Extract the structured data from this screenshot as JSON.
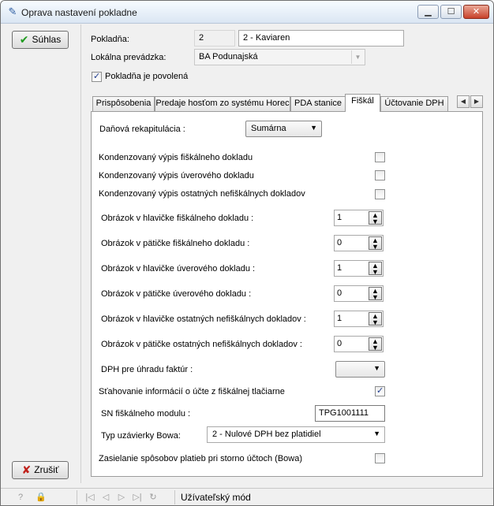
{
  "window": {
    "title": "Oprava nastavení pokladne",
    "icon": "register-icon"
  },
  "buttons": {
    "ok_label": "Súhlas",
    "cancel_label": "Zrušiť"
  },
  "header": {
    "register_label": "Pokladňa:",
    "register_number": "2",
    "register_name": "2 - Kaviaren",
    "branch_label": "Lokálna prevádzka:",
    "branch_value": "BA Podunajská",
    "enabled_label": "Pokladňa je povolená",
    "enabled_checked": true
  },
  "tabs": [
    {
      "label": "Prispôsobenia",
      "active": false
    },
    {
      "label": "Predaje hosťom zo systému Horec",
      "active": false
    },
    {
      "label": "PDA stanice",
      "active": false
    },
    {
      "label": "Fiškál",
      "active": true
    },
    {
      "label": "Účtovanie DPH",
      "active": false
    }
  ],
  "fiscal": {
    "tax_recap_label": "Daňová rekapitulácia :",
    "tax_recap_value": "Sumárna",
    "condensed_fiscal_label": "Kondenzovaný výpis fiškálneho dokladu",
    "condensed_fiscal_checked": false,
    "condensed_credit_label": "Kondenzovaný výpis úverového dokladu",
    "condensed_credit_checked": false,
    "condensed_other_label": "Kondenzovaný výpis ostatných nefiškálnych dokladov",
    "condensed_other_checked": false,
    "img_fiscal_header_label": "Obrázok v hlavičke fiškálneho dokladu :",
    "img_fiscal_header_value": "1",
    "img_fiscal_footer_label": "Obrázok v pätičke fiškálneho dokladu :",
    "img_fiscal_footer_value": "0",
    "img_credit_header_label": "Obrázok v hlavičke úverového dokladu :",
    "img_credit_header_value": "1",
    "img_credit_footer_label": "Obrázok v pätičke úverového dokladu :",
    "img_credit_footer_value": "0",
    "img_other_header_label": "Obrázok v hlavičke ostatných nefiškálnych dokladov :",
    "img_other_header_value": "1",
    "img_other_footer_label": "Obrázok v pätičke ostatných nefiškálnych dokladov :",
    "img_other_footer_value": "0",
    "vat_invoice_label": "DPH pre úhradu faktúr :",
    "vat_invoice_value": "",
    "download_info_label": "Sťahovanie informácií o účte z fiškálnej tlačiarne",
    "download_info_checked": true,
    "sn_label": "SN fiškálneho modulu :",
    "sn_value": "TPG1001111",
    "bowa_type_label": "Typ uzávierky Bowa:",
    "bowa_type_value": "2 - Nulové DPH bez platidiel",
    "bowa_storno_label": "Zasielanie spôsobov platieb pri storno účtoch (Bowa)",
    "bowa_storno_checked": false
  },
  "statusbar": {
    "mode_text": "Užívateľský mód"
  }
}
